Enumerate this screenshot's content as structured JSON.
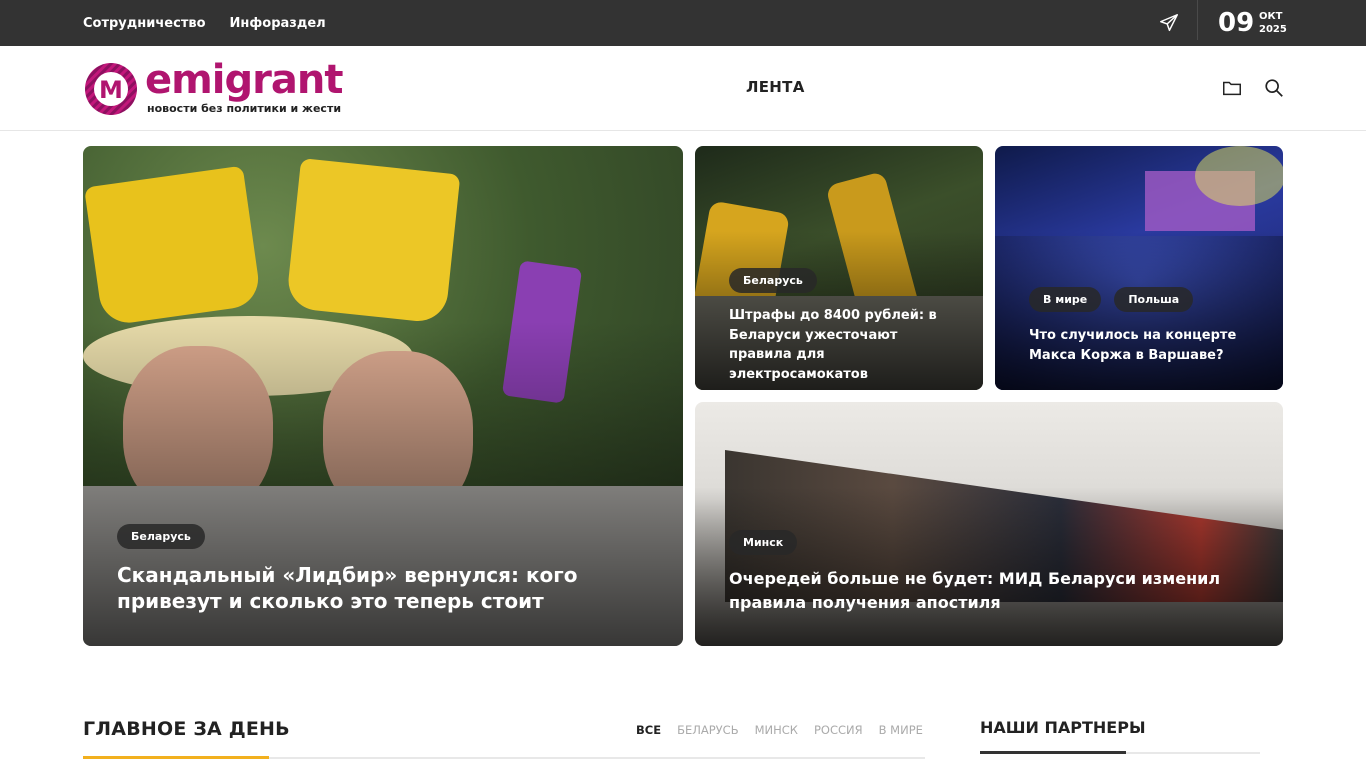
{
  "topbar": {
    "links": [
      "Сотрудничество",
      "Инфораздел"
    ],
    "date_day": "09",
    "date_month": "ОКТ",
    "date_year": "2025"
  },
  "header": {
    "logo_text": "emigrant",
    "logo_mark": "M",
    "tagline": "новости без политики и жести",
    "nav_item": "ЛЕНТА",
    "icons": [
      "folder-icon",
      "search-icon"
    ]
  },
  "featured": {
    "main": {
      "tags": [
        "Беларусь"
      ],
      "title": "Скандальный «Лидбир» вернулся: кого привезут и сколько это теперь стоит"
    },
    "top_middle": {
      "tags": [
        "Беларусь"
      ],
      "title": "Штрафы до 8400 рублей: в Беларуси ужесточают правила для электросамокатов"
    },
    "top_right": {
      "tags": [
        "В мире",
        "Польша"
      ],
      "title": "Что случилось на концерте Макса Коржа в Варшаве?"
    },
    "bottom_wide": {
      "tags": [
        "Минск"
      ],
      "title": "Очередей больше не будет: МИД Беларуси изменил правила получения апостиля"
    }
  },
  "main_section": {
    "title": "ГЛАВНОЕ ЗА ДЕНЬ",
    "filters": [
      "ВСЕ",
      "БЕЛАРУСЬ",
      "МИНСК",
      "РОССИЯ",
      "В МИРЕ"
    ],
    "active_filter": "ВСЕ"
  },
  "partners": {
    "title": "НАШИ ПАРТНЕРЫ"
  },
  "colors": {
    "brand": "#b0156f",
    "topbar": "#333333",
    "accent": "#f2b01e"
  }
}
